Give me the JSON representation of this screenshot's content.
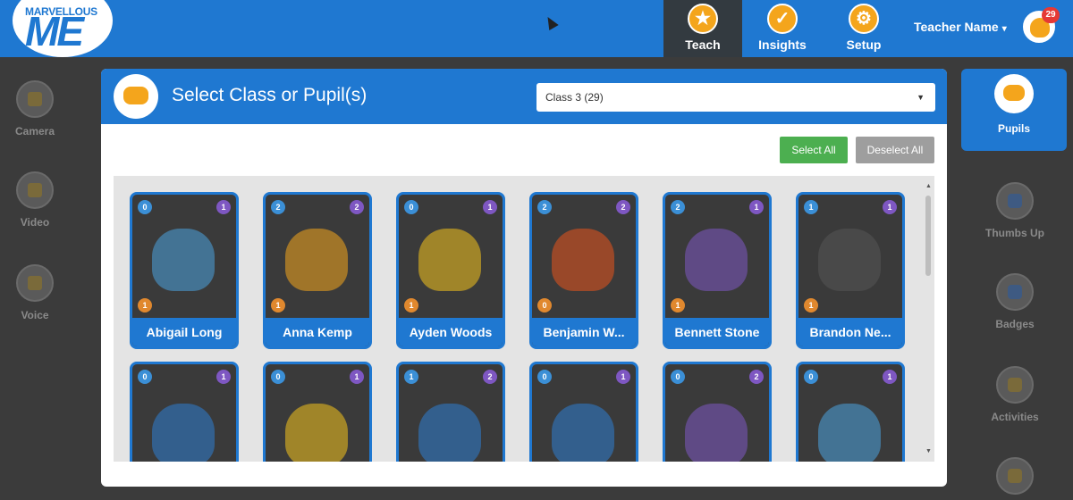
{
  "topbar": {
    "logo_top": "MARVELLOUS",
    "logo_main": "ME",
    "nav": [
      {
        "label": "Teach",
        "icon": "star-icon"
      },
      {
        "label": "Insights",
        "icon": "checkmark-icon"
      },
      {
        "label": "Setup",
        "icon": "gear-icon"
      }
    ],
    "teacher_name": "Teacher Name",
    "notifications": "29"
  },
  "left_sidebar": [
    {
      "label": "Camera",
      "icon": "camera-icon"
    },
    {
      "label": "Video",
      "icon": "video-icon"
    },
    {
      "label": "Voice",
      "icon": "microphone-icon"
    }
  ],
  "right_sidebar": {
    "active": {
      "label": "Pupils",
      "icon": "pupils-icon"
    },
    "tools": [
      {
        "label": "Thumbs Up",
        "icon": "thumbs-up-icon"
      },
      {
        "label": "Badges",
        "icon": "badge-icon"
      },
      {
        "label": "Activities",
        "icon": "activities-icon"
      }
    ]
  },
  "panel": {
    "title": "Select Class or Pupil(s)",
    "class_selected": "Class 3 (29)",
    "select_all": "Select All",
    "deselect_all": "Deselect All"
  },
  "pupils": [
    {
      "name": "Abigail Long",
      "tl": "0",
      "tr": "1",
      "bl": "1",
      "color": "#4aa3df"
    },
    {
      "name": "Anna Kemp",
      "tl": "2",
      "tr": "2",
      "bl": "1",
      "color": "#f4a51c"
    },
    {
      "name": "Ayden Woods",
      "tl": "0",
      "tr": "1",
      "bl": "1",
      "color": "#f4c31c"
    },
    {
      "name": "Benjamin W...",
      "tl": "2",
      "tr": "2",
      "bl": "0",
      "color": "#e8541c"
    },
    {
      "name": "Bennett Stone",
      "tl": "2",
      "tr": "1",
      "bl": "1",
      "color": "#7e57c2"
    },
    {
      "name": "Brandon Ne...",
      "tl": "1",
      "tr": "1",
      "bl": "1",
      "color": "#555555"
    },
    {
      "name": "",
      "tl": "0",
      "tr": "1",
      "bl": "",
      "color": "#2e7dd1"
    },
    {
      "name": "",
      "tl": "0",
      "tr": "1",
      "bl": "",
      "color": "#f4c31c"
    },
    {
      "name": "",
      "tl": "1",
      "tr": "2",
      "bl": "",
      "color": "#2e7dd1"
    },
    {
      "name": "",
      "tl": "0",
      "tr": "1",
      "bl": "",
      "color": "#2e7dd1"
    },
    {
      "name": "",
      "tl": "0",
      "tr": "2",
      "bl": "",
      "color": "#7e57c2"
    },
    {
      "name": "",
      "tl": "0",
      "tr": "1",
      "bl": "",
      "color": "#4aa3df"
    }
  ]
}
